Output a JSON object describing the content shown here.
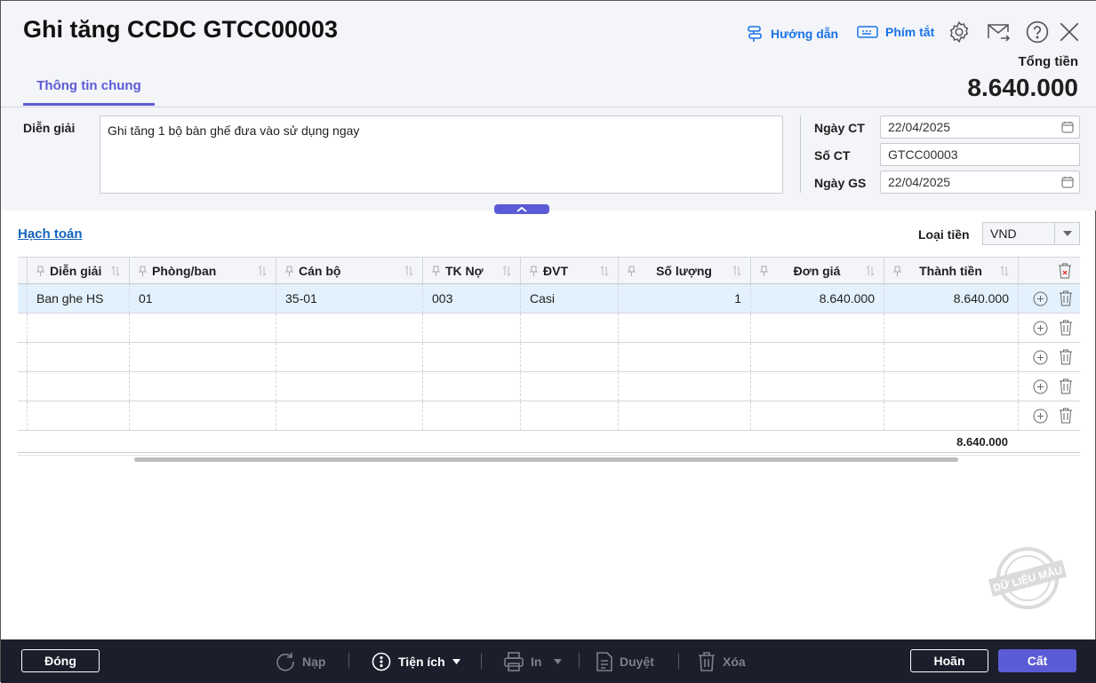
{
  "header": {
    "title": "Ghi tăng CCDC GTCC00003",
    "guide_label": "Hướng dẫn",
    "shortcut_label": "Phím tắt",
    "total_label": "Tổng tiền",
    "total_value": "8.640.000"
  },
  "tabs": [
    {
      "label": "Thông tin chung",
      "active": true
    }
  ],
  "form": {
    "description_label": "Diễn giải",
    "description_value": "Ghi tăng 1 bộ bàn ghế đưa vào sử dụng ngay",
    "date_ct_label": "Ngày CT",
    "date_ct_value": "22/04/2025",
    "so_ct_label": "Số CT",
    "so_ct_value": "GTCC00003",
    "date_gs_label": "Ngày GS",
    "date_gs_value": "22/04/2025"
  },
  "section": {
    "link_label": "Hạch toán",
    "currency_label": "Loại tiền",
    "currency_value": "VND"
  },
  "grid": {
    "columns": [
      "Diễn giải",
      "Phòng/ban",
      "Cán bộ",
      "TK Nợ",
      "ĐVT",
      "Số lượng",
      "Đơn giá",
      "Thành tiền"
    ],
    "rows": [
      [
        "Ban ghe HS",
        "01",
        "35-01",
        "003",
        "Casi",
        "1",
        "8.640.000",
        "8.640.000"
      ]
    ],
    "empty_rows": 4,
    "footer_total": "8.640.000"
  },
  "footer": {
    "close": "Đóng",
    "reload": "Nạp",
    "utilities": "Tiện ích",
    "print": "In",
    "approve": "Duyệt",
    "delete": "Xóa",
    "cancel": "Hoãn",
    "save": "Cất"
  },
  "watermark": "DỮ LIỆU MẪU",
  "colors": {
    "accent": "#5b5bd6",
    "link": "#1a73e8",
    "footer_bg": "#1c1e2b",
    "row_selected": "#e3f1fc"
  }
}
